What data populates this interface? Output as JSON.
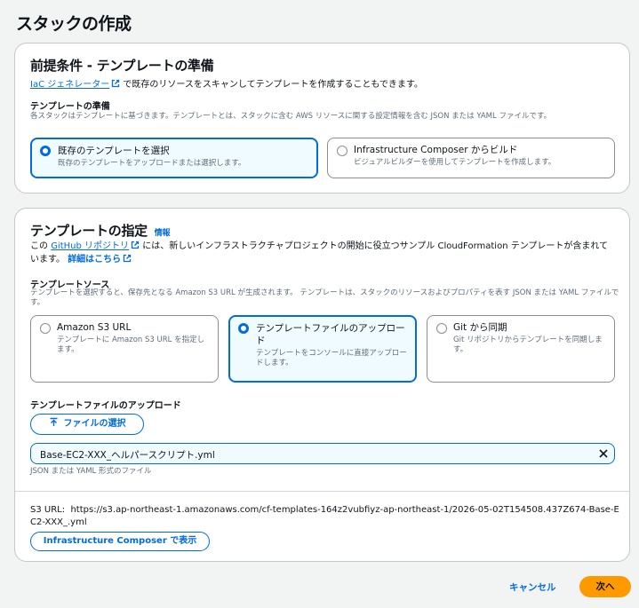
{
  "page": {
    "title": "スタックの作成"
  },
  "prereq": {
    "title": "前提条件 - テンプレートの準備",
    "iac_link": "IaC ジェネレーター",
    "iac_text": " で既存のリソースをスキャンしてテンプレートを作成することもできます。",
    "prepare_label": "テンプレートの準備",
    "prepare_desc": "各スタックはテンプレートに基づきます。テンプレートとは、スタックに含む AWS リソースに関する設定情報を含む JSON または YAML ファイルです。",
    "options": [
      {
        "title": "既存のテンプレートを選択",
        "desc": "既存のテンプレートをアップロードまたは選択します。",
        "selected": true
      },
      {
        "title": "Infrastructure Composer からビルド",
        "desc": "ビジュアルビルダーを使用してテンプレートを作成します。",
        "selected": false
      }
    ]
  },
  "spec": {
    "title": "テンプレートの指定",
    "info_link": "情報",
    "intro_pre": "この ",
    "github_link": "GitHub リポジトリ",
    "intro_mid": " には、新しいインフラストラクチャプロジェクトの開始に役立つサンプル CloudFormation テンプレートが含まれています。",
    "details_link": "詳細はこちら",
    "source_label": "テンプレートソース",
    "source_desc": "テンプレートを選択すると、保存先となる Amazon S3 URL が生成されます。 テンプレートは、スタックのリソースおよびプロパティを表す JSON または YAML ファイルです。",
    "sources": [
      {
        "title": "Amazon S3 URL",
        "desc": "テンプレートに Amazon S3 URL を指定します。",
        "selected": false
      },
      {
        "title": "テンプレートファイルのアップロード",
        "desc": "テンプレートをコンソールに直接アップロードします。",
        "selected": true
      },
      {
        "title": "Git から同期",
        "desc": "Git リポジトリからテンプレートを同期します。",
        "selected": false
      }
    ],
    "upload_label": "テンプレートファイルのアップロード",
    "choose_file": "ファイルの選択",
    "file_name": "Base-EC2-XXX_ヘルパースクリプト.yml",
    "file_hint": "JSON または YAML 形式のファイル",
    "s3_label": "S3 URL:",
    "s3_url": "https://s3.ap-northeast-1.amazonaws.com/cf-templates-164z2vubfiyz-ap-northeast-1/2026-05-02T154508.437Z674-Base-EC2-XXX_.yml",
    "view_composer": "Infrastructure Composer で表示"
  },
  "footer": {
    "cancel": "キャンセル",
    "next": "次へ"
  },
  "colors": {
    "accent": "#006ce0",
    "primary_button": "#ff9900"
  },
  "icons": {
    "external": "external-link-icon",
    "upload": "upload-icon",
    "clear": "close-icon"
  }
}
